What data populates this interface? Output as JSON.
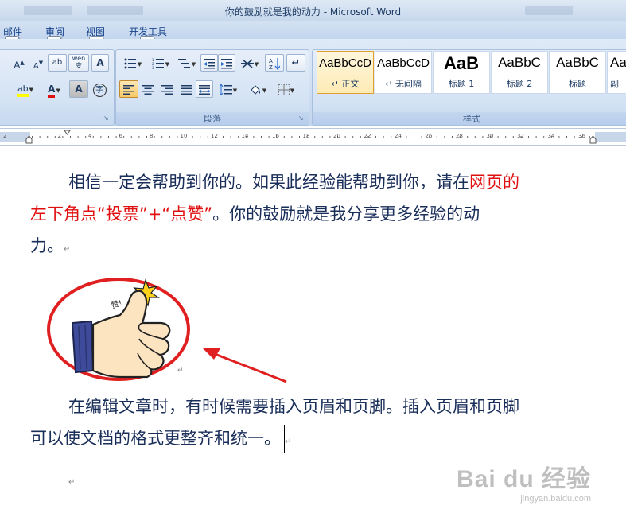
{
  "window": {
    "title": "你的鼓励就是我的动力 - Microsoft Word"
  },
  "tabs": [
    {
      "label": "邮件",
      "keytip": "M"
    },
    {
      "label": "审阅",
      "keytip": "R"
    },
    {
      "label": "视图",
      "keytip": "W"
    },
    {
      "label": "开发工具",
      "keytip": "L"
    }
  ],
  "ribbon": {
    "paragraph_group_label": "段落",
    "styles_group_label": "样式",
    "font_buttons": {
      "grow": "A",
      "shrink": "A",
      "clear": "ab",
      "phonetic": "wén\n变",
      "border": "A",
      "highlight": "ab",
      "color": "A",
      "shade": "A",
      "enclose": "字"
    },
    "styles": [
      {
        "sample": "AaBbCcD",
        "name": "↵ 正文"
      },
      {
        "sample": "AaBbCcD",
        "name": "↵ 无间隔"
      },
      {
        "sample": "AaB",
        "name": "标题 1"
      },
      {
        "sample": "AaBbC",
        "name": "标题 2"
      },
      {
        "sample": "AaBbC",
        "name": "标题"
      },
      {
        "sample": "Aa",
        "name": "副"
      }
    ]
  },
  "ruler": {
    "ticks": [
      "2",
      "2",
      "4",
      "6",
      "8",
      "10",
      "12",
      "14",
      "16",
      "18",
      "20",
      "22",
      "24",
      "26",
      "28",
      "30",
      "32",
      "34",
      "36"
    ]
  },
  "document": {
    "para1": {
      "line1_a": "相信一定会帮助到你的。如果此经验能帮助到你，请在",
      "line1_red": "网页的",
      "line2_red": "左下角点“投票”+“点赞”",
      "line2_b": "。你的鼓励就是我分享更多经验的动",
      "line3": "力。"
    },
    "image_text": "赞!",
    "para2": {
      "line1": "在编辑文章时，有时候需要插入页眉和页脚。插入页眉和页脚",
      "line2": "可以使文档的格式更整齐和统一。"
    },
    "paragraph_mark": "↵"
  },
  "watermark": {
    "main": "Bai du 经验",
    "url": "jingyan.baidu.com"
  },
  "colors": {
    "body_text": "#1a2e5a",
    "highlight_red": "#e01010",
    "circle_red": "#e02020"
  }
}
